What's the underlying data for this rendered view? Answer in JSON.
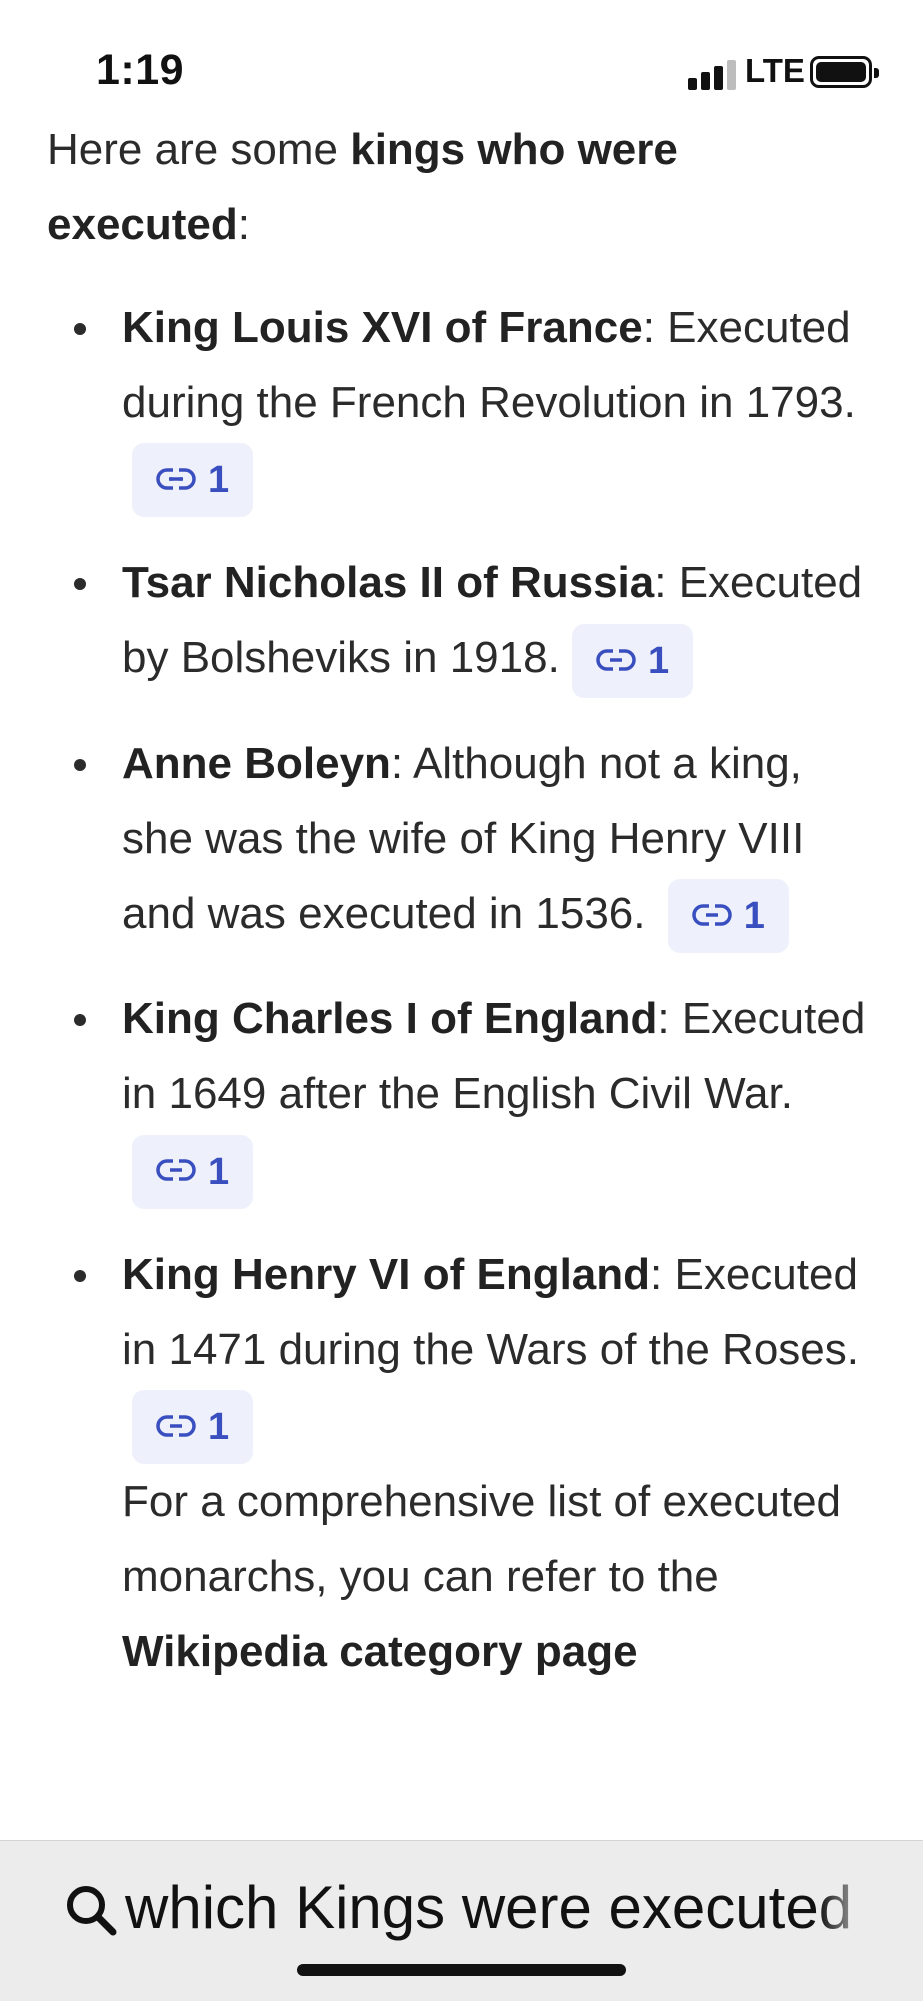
{
  "status_bar": {
    "time": "1:19",
    "network": "LTE"
  },
  "answer": {
    "intro_prefix": "Here are some ",
    "intro_bold": "kings who were executed",
    "intro_suffix": ":",
    "items": [
      {
        "name": "King Louis XVI of France",
        "text": "Executed during the French Revolution in 1793.",
        "citation": "1"
      },
      {
        "name": "Tsar Nicholas II of Russia",
        "text": "Executed by Bolsheviks in 1918.",
        "citation": "1"
      },
      {
        "name": "Anne Boleyn",
        "text": "Although not a king, she was the wife of King Henry VIII and was executed in 1536.",
        "citation": "1"
      },
      {
        "name": "King Charles I of England",
        "text": "Executed in 1649 after the English Civil War.",
        "citation": "1"
      },
      {
        "name": "King Henry VI of England",
        "text": "Executed in 1471 during the Wars of the Roses.",
        "citation": "1"
      }
    ],
    "outro_prefix": "For a comprehensive list of executed monarchs, you can refer to the ",
    "outro_bold": "Wikipedia category page"
  },
  "search": {
    "query": "which Kings were executed",
    "icon": "search-icon"
  },
  "colors": {
    "citation_bg": "#eef0fb",
    "citation_text": "#3a4fbf",
    "search_bar_bg": "#ececec"
  }
}
